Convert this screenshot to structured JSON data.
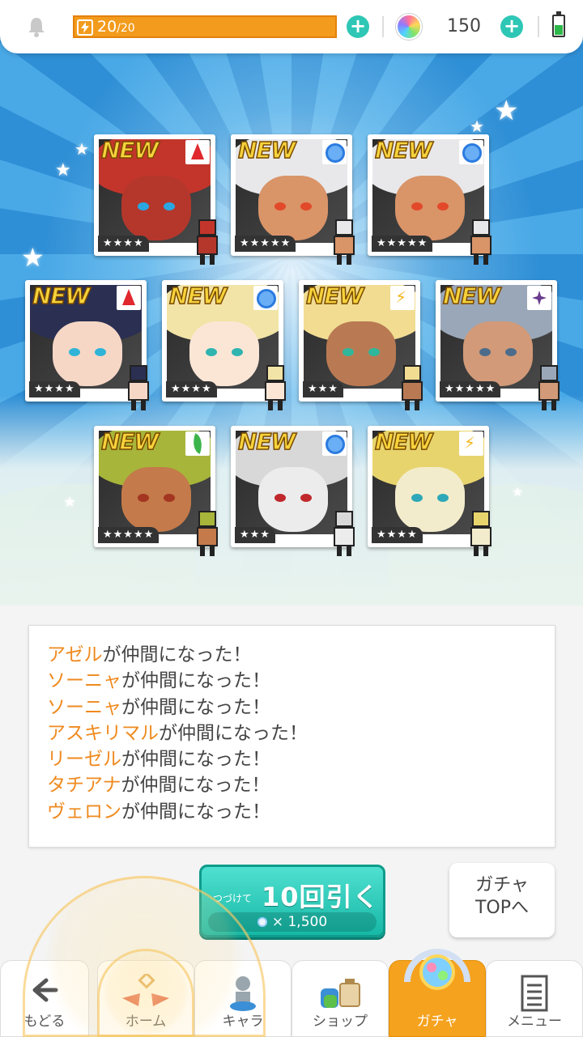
{
  "status_bar": {
    "stamina_current": "20",
    "stamina_max": "/20",
    "stamina_fraction": 1.0,
    "gem_count": "150"
  },
  "cards": [
    {
      "new_label": "NEW",
      "attribute": "fire",
      "stars": "★★★★",
      "hair_color": "#c3352b",
      "skin_color": "#b5372c",
      "eye_color": "#2aa7e0"
    },
    {
      "new_label": "NEW",
      "attribute": "water",
      "stars": "★★★★★",
      "hair_color": "#e8e8ea",
      "skin_color": "#d99468",
      "eye_color": "#e2492a"
    },
    {
      "new_label": "NEW",
      "attribute": "water",
      "stars": "★★★★★",
      "hair_color": "#e8e8ea",
      "skin_color": "#d99468",
      "eye_color": "#e2492a"
    },
    {
      "new_label": "NEW",
      "attribute": "fire",
      "stars": "★★★★",
      "hair_color": "#2b2f52",
      "skin_color": "#f6d7c6",
      "eye_color": "#2fb4d8"
    },
    {
      "new_label": "NEW",
      "attribute": "water",
      "stars": "★★★★",
      "hair_color": "#f2e4a6",
      "skin_color": "#fbe6d6",
      "eye_color": "#2fb4b0"
    },
    {
      "new_label": "NEW",
      "attribute": "light",
      "stars": "★★★",
      "hair_color": "#f1dc92",
      "skin_color": "#b97a53",
      "eye_color": "#30b79b"
    },
    {
      "new_label": "NEW",
      "attribute": "dark",
      "stars": "★★★★★",
      "hair_color": "#9aa7b8",
      "skin_color": "#d29a78",
      "eye_color": "#4d6c8c"
    },
    {
      "new_label": "NEW",
      "attribute": "wood",
      "stars": "★★★★★",
      "hair_color": "#a7b53a",
      "skin_color": "#c47a4a",
      "eye_color": "#a43520"
    },
    {
      "new_label": "NEW",
      "attribute": "water",
      "stars": "★★★",
      "hair_color": "#d8d8d8",
      "skin_color": "#ececec",
      "eye_color": "#c0282b"
    },
    {
      "new_label": "NEW",
      "attribute": "light",
      "stars": "★★★★",
      "hair_color": "#e7d46d",
      "skin_color": "#f3eccc",
      "eye_color": "#2ea8b8"
    }
  ],
  "log": [
    {
      "name": "アゼル",
      "text": "が仲間になった！"
    },
    {
      "name": "ソーニャ",
      "text": "が仲間になった！"
    },
    {
      "name": "ソーニャ",
      "text": "が仲間になった！"
    },
    {
      "name": "アスキリマル",
      "text": "が仲間になった！"
    },
    {
      "name": "リーゼル",
      "text": "が仲間になった！"
    },
    {
      "name": "タチアナ",
      "text": "が仲間になった！"
    },
    {
      "name": "ヴェロン",
      "text": "が仲間になった！"
    }
  ],
  "draw_button": {
    "prefix": "つづけて",
    "label": "10回引く",
    "cost": "× 1,500"
  },
  "gacha_top_button": {
    "line1": "ガチャ",
    "line2": "TOPへ"
  },
  "nav": {
    "back": "もどる",
    "home": "ホーム",
    "chara": "キャラ",
    "shop": "ショップ",
    "gacha": "ガチャ",
    "menu": "メニュー"
  },
  "colors": {
    "accent_orange": "#f5a21e",
    "teal": "#2ec7b5",
    "name_orange": "#ef8a1f"
  }
}
